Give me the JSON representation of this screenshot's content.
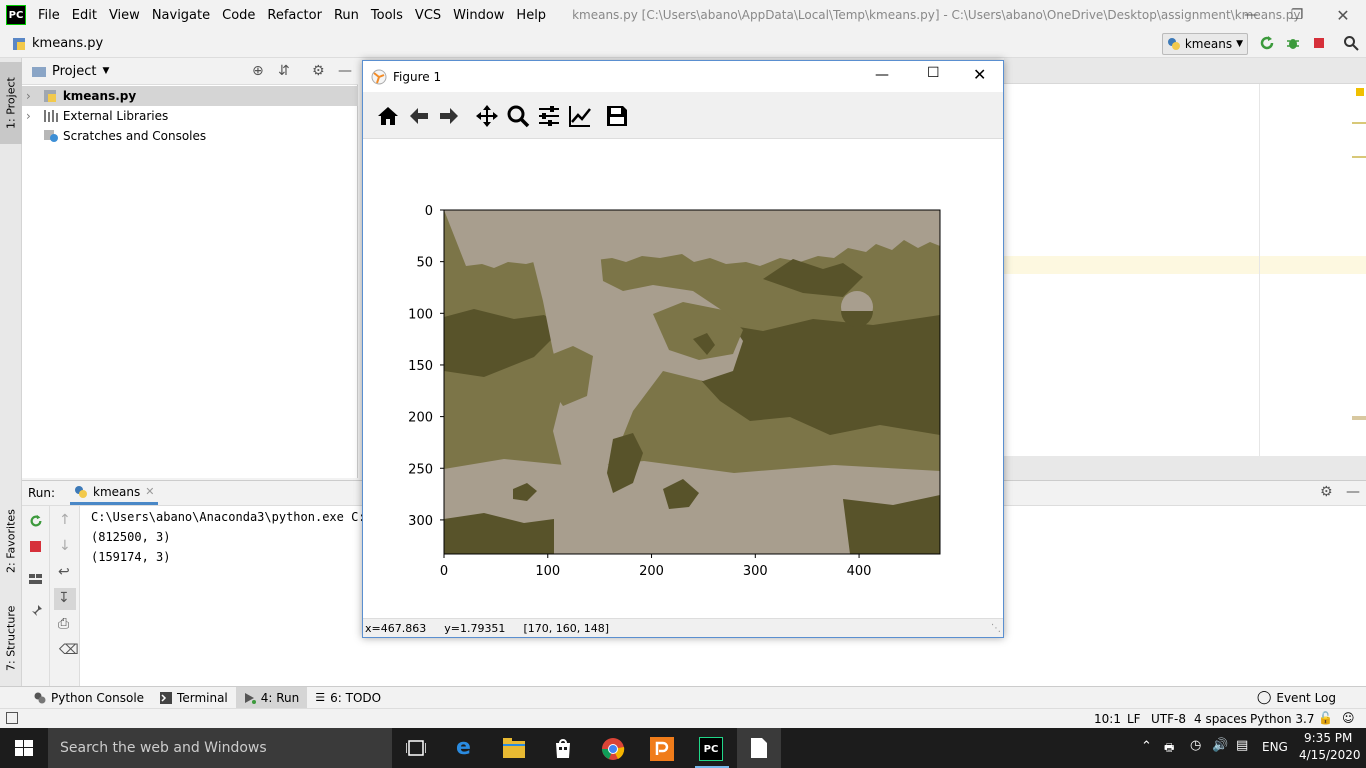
{
  "app": {
    "logo_text": "PC",
    "window_title": "kmeans.py [C:\\Users\\abano\\AppData\\Local\\Temp\\kmeans.py] - C:\\Users\\abano\\OneDrive\\Desktop\\assignment\\kmeans.py",
    "menu": [
      "File",
      "Edit",
      "View",
      "Navigate",
      "Code",
      "Refactor",
      "Run",
      "Tools",
      "VCS",
      "Window",
      "Help"
    ]
  },
  "navbar": {
    "file": "kmeans.py",
    "run_config": "kmeans"
  },
  "left_tabs": {
    "project": "1: Project",
    "favorites": "2: Favorites",
    "structure": "7: Structure"
  },
  "project": {
    "title": "Project",
    "items": [
      "kmeans.py",
      "External Libraries",
      "Scratches and Consoles"
    ]
  },
  "run": {
    "label": "Run:",
    "tab": "kmeans",
    "lines": [
      "C:\\Users\\abano\\Anaconda3\\python.exe C:/",
      "(812500, 3)",
      "(159174, 3)"
    ]
  },
  "tool_tabs": [
    "Python Console",
    "Terminal",
    "4: Run",
    "6: TODO"
  ],
  "event_log": "Event Log",
  "status": {
    "position": "10:1",
    "line_sep": "LF",
    "encoding": "UTF-8",
    "indent": "4 spaces",
    "interpreter": "Python 3.7"
  },
  "taskbar": {
    "search_placeholder": "Search the web and Windows",
    "lang": "ENG",
    "time": "9:35 PM",
    "date": "4/15/2020"
  },
  "figure": {
    "title": "Figure 1",
    "status_x": "x=467.863",
    "status_y": "y=1.79351",
    "status_rgb": "[170, 160, 148]"
  },
  "chart_data": {
    "type": "heatmap",
    "description_colors": [
      "#a89e8e",
      "#7c7548",
      "#58532a"
    ],
    "x_ticks": [
      0,
      100,
      200,
      300,
      400
    ],
    "y_ticks": [
      0,
      50,
      100,
      150,
      200,
      250,
      300
    ],
    "xlim": [
      0,
      478
    ],
    "ylim": [
      333,
      0
    ]
  },
  "colors": {
    "accent": "#5a8fd0",
    "stop_red": "#d6303a",
    "run_green": "#3c9a3c",
    "taskbar": "#1c1c1c"
  }
}
